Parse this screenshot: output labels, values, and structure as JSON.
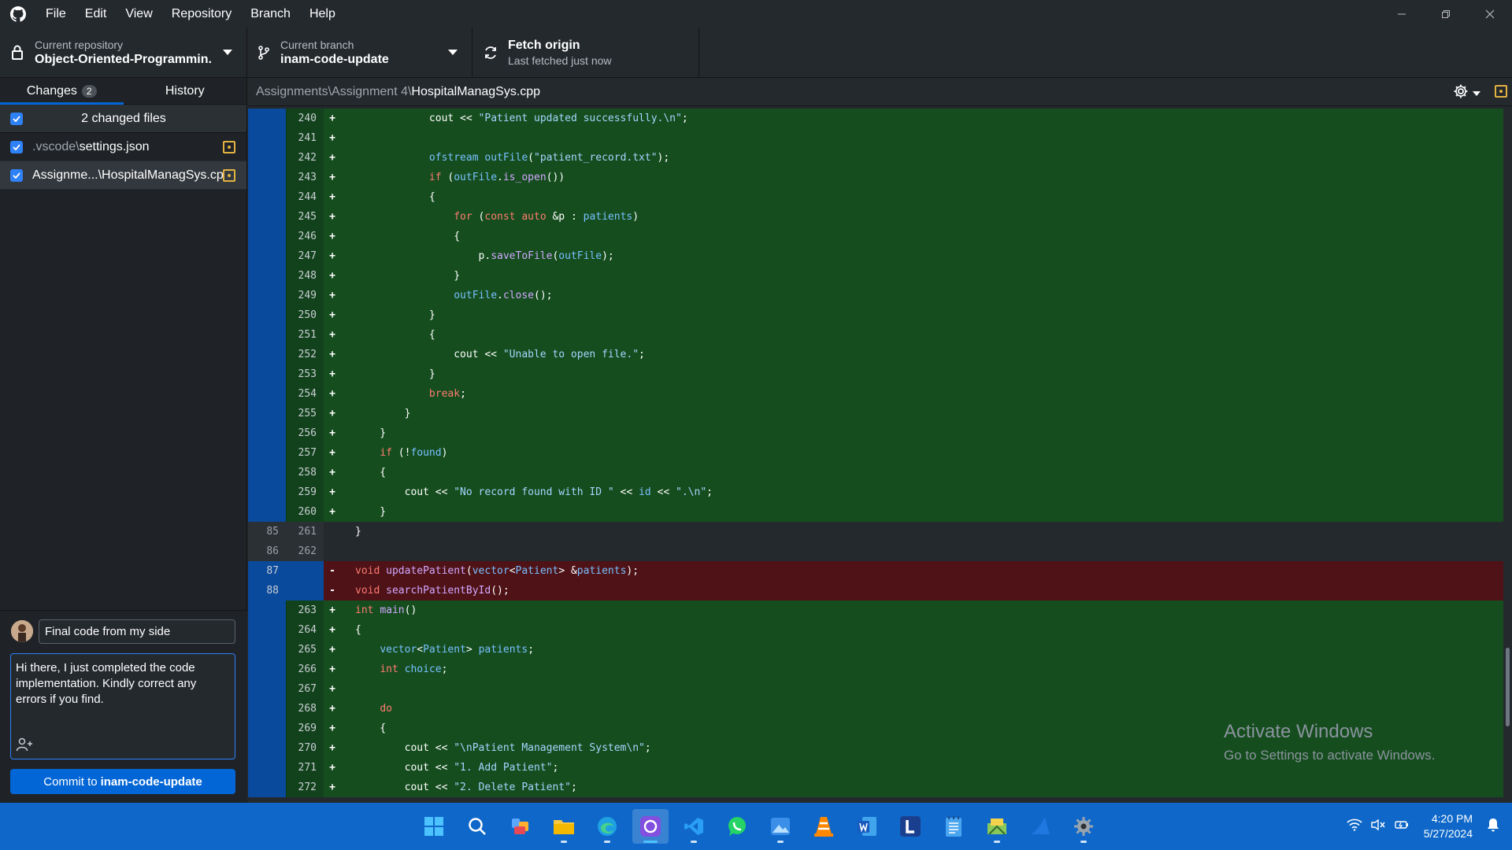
{
  "menu": [
    "File",
    "Edit",
    "View",
    "Repository",
    "Branch",
    "Help"
  ],
  "toolbar": {
    "repo_label": "Current repository",
    "repo_value": "Object-Oriented-Programmin...",
    "branch_label": "Current branch",
    "branch_value": "inam-code-update",
    "fetch_label": "Fetch origin",
    "fetch_sub": "Last fetched just now"
  },
  "sidebar": {
    "tab_changes": "Changes",
    "changes_count": "2",
    "tab_history": "History",
    "files_header": "2 changed files",
    "files": [
      {
        "dir": ".vscode\\",
        "name": "settings.json"
      },
      {
        "dir": "",
        "name": "Assignme...\\HospitalManagSys.cpp"
      }
    ]
  },
  "commit": {
    "summary": "Final code from my side",
    "description": "Hi there, I just completed the code implementation. Kindly correct any errors if you find.",
    "button_prefix": "Commit to",
    "button_branch": "inam-code-update"
  },
  "diff": {
    "path_dir": "Assignments\\Assignment 4\\",
    "path_file": "HospitalManagSys.cpp",
    "lines": [
      {
        "type": "add",
        "old": "",
        "new": "240",
        "sign": "+",
        "code": "            cout << \"Patient updated successfully.\\n\";"
      },
      {
        "type": "add",
        "old": "",
        "new": "241",
        "sign": "+",
        "code": ""
      },
      {
        "type": "add",
        "old": "",
        "new": "242",
        "sign": "+",
        "code": "            ofstream outFile(\"patient_record.txt\");"
      },
      {
        "type": "add",
        "old": "",
        "new": "243",
        "sign": "+",
        "code": "            if (outFile.is_open())"
      },
      {
        "type": "add",
        "old": "",
        "new": "244",
        "sign": "+",
        "code": "            {"
      },
      {
        "type": "add",
        "old": "",
        "new": "245",
        "sign": "+",
        "code": "                for (const auto &p : patients)"
      },
      {
        "type": "add",
        "old": "",
        "new": "246",
        "sign": "+",
        "code": "                {"
      },
      {
        "type": "add",
        "old": "",
        "new": "247",
        "sign": "+",
        "code": "                    p.saveToFile(outFile);"
      },
      {
        "type": "add",
        "old": "",
        "new": "248",
        "sign": "+",
        "code": "                }"
      },
      {
        "type": "add",
        "old": "",
        "new": "249",
        "sign": "+",
        "code": "                outFile.close();"
      },
      {
        "type": "add",
        "old": "",
        "new": "250",
        "sign": "+",
        "code": "            }"
      },
      {
        "type": "add",
        "old": "",
        "new": "251",
        "sign": "+",
        "code": "            {"
      },
      {
        "type": "add",
        "old": "",
        "new": "252",
        "sign": "+",
        "code": "                cout << \"Unable to open file.\";"
      },
      {
        "type": "add",
        "old": "",
        "new": "253",
        "sign": "+",
        "code": "            }"
      },
      {
        "type": "add",
        "old": "",
        "new": "254",
        "sign": "+",
        "code": "            break;"
      },
      {
        "type": "add",
        "old": "",
        "new": "255",
        "sign": "+",
        "code": "        }"
      },
      {
        "type": "add",
        "old": "",
        "new": "256",
        "sign": "+",
        "code": "    }"
      },
      {
        "type": "add",
        "old": "",
        "new": "257",
        "sign": "+",
        "code": "    if (!found)"
      },
      {
        "type": "add",
        "old": "",
        "new": "258",
        "sign": "+",
        "code": "    {"
      },
      {
        "type": "add",
        "old": "",
        "new": "259",
        "sign": "+",
        "code": "        cout << \"No record found with ID \" << id << \".\\n\";"
      },
      {
        "type": "add",
        "old": "",
        "new": "260",
        "sign": "+",
        "code": "    }"
      },
      {
        "type": "context",
        "old": "85",
        "new": "261",
        "sign": "",
        "code": "}"
      },
      {
        "type": "context",
        "old": "86",
        "new": "262",
        "sign": "",
        "code": ""
      },
      {
        "type": "del",
        "old": "87",
        "new": "",
        "sign": "-",
        "code": "void updatePatient(vector<Patient> &patients);"
      },
      {
        "type": "del",
        "old": "88",
        "new": "",
        "sign": "-",
        "code": "void searchPatientById();"
      },
      {
        "type": "add",
        "old": "",
        "new": "263",
        "sign": "+",
        "code": "int main()"
      },
      {
        "type": "add",
        "old": "",
        "new": "264",
        "sign": "+",
        "code": "{"
      },
      {
        "type": "add",
        "old": "",
        "new": "265",
        "sign": "+",
        "code": "    vector<Patient> patients;"
      },
      {
        "type": "add",
        "old": "",
        "new": "266",
        "sign": "+",
        "code": "    int choice;"
      },
      {
        "type": "add",
        "old": "",
        "new": "267",
        "sign": "+",
        "code": ""
      },
      {
        "type": "add",
        "old": "",
        "new": "268",
        "sign": "+",
        "code": "    do"
      },
      {
        "type": "add",
        "old": "",
        "new": "269",
        "sign": "+",
        "code": "    {"
      },
      {
        "type": "add",
        "old": "",
        "new": "270",
        "sign": "+",
        "code": "        cout << \"\\nPatient Management System\\n\";"
      },
      {
        "type": "add",
        "old": "",
        "new": "271",
        "sign": "+",
        "code": "        cout << \"1. Add Patient\";"
      },
      {
        "type": "add",
        "old": "",
        "new": "272",
        "sign": "+",
        "code": "        cout << \"2. Delete Patient\";"
      }
    ]
  },
  "watermark": {
    "title": "Activate Windows",
    "sub": "Go to Settings to activate Windows."
  },
  "taskbar": {
    "time": "4:20 PM",
    "date": "5/27/2024",
    "apps": [
      "windows-start-icon",
      "search-icon",
      "widgets-icon",
      "file-explorer-icon",
      "edge-icon",
      "github-desktop-icon",
      "vscode-icon",
      "whatsapp-icon",
      "photos-icon",
      "vlc-icon",
      "word-icon",
      "l-app-icon",
      "notepad-icon",
      "network-app-icon",
      "shark-app-icon",
      "settings-icon"
    ]
  },
  "colors": {
    "accent": "#0366d6",
    "added_bg": "#154d1e",
    "deleted_bg": "#4e1217",
    "taskbar": "#0f68c9"
  }
}
